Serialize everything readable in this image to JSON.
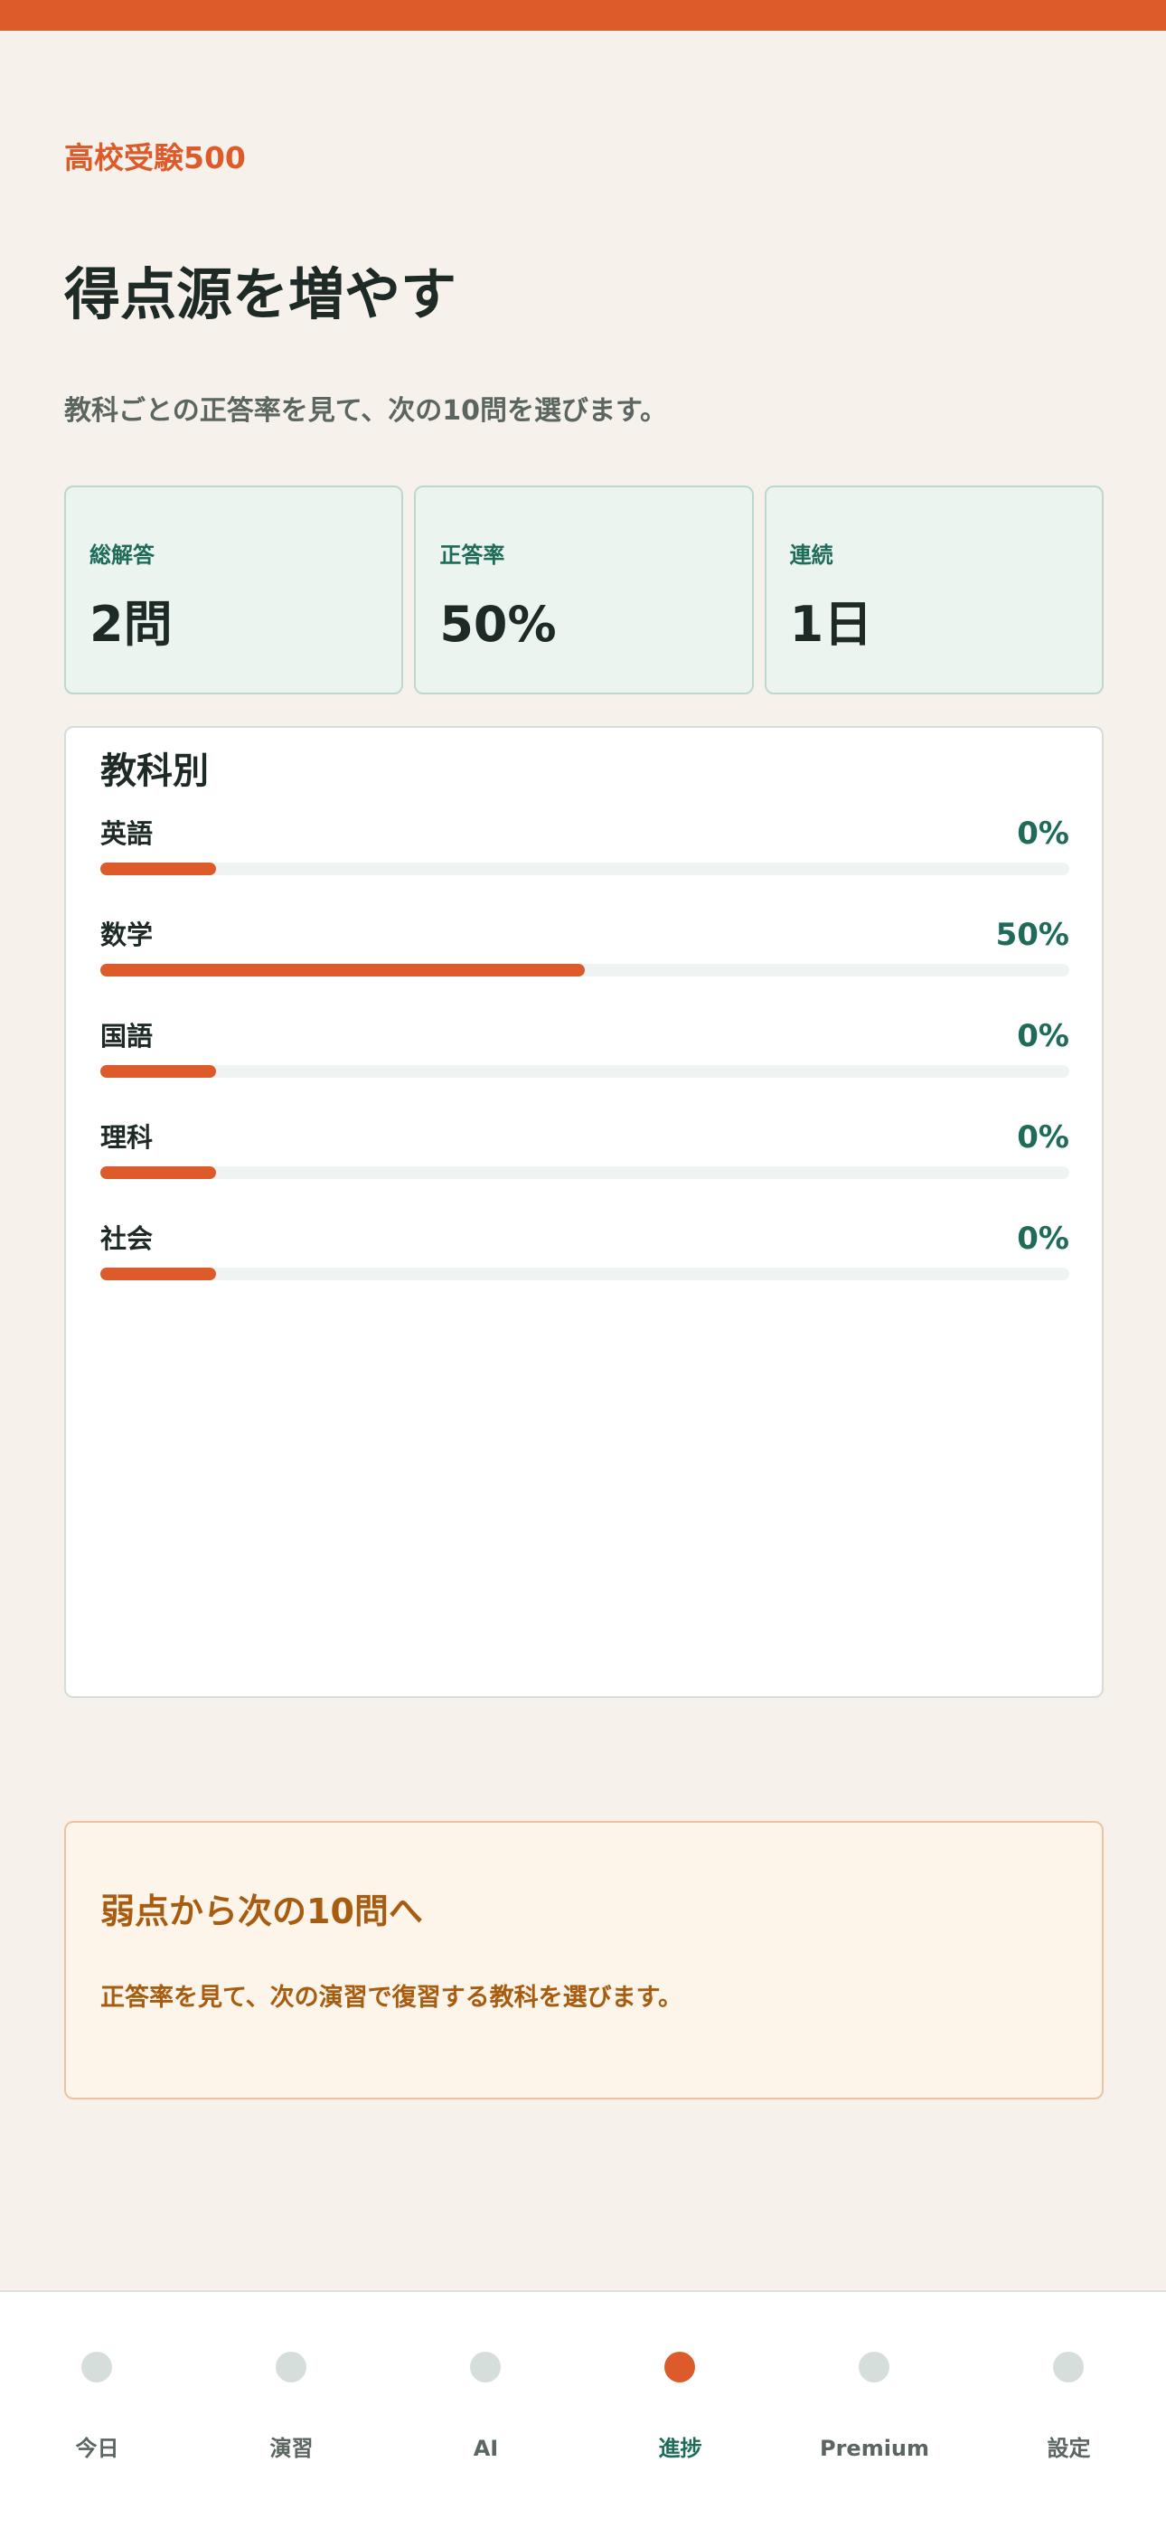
{
  "app": {
    "name": "高校受験500"
  },
  "header": {
    "title": "得点源を増やす",
    "subtitle": "教科ごとの正答率を見て、次の10問を選びます。"
  },
  "stats": [
    {
      "label": "総解答",
      "value": "2問"
    },
    {
      "label": "正答率",
      "value": "50%"
    },
    {
      "label": "連続",
      "value": "1日"
    }
  ],
  "subjects": {
    "title": "教科別",
    "items": [
      {
        "name": "英語",
        "percent_label": "0%",
        "progress": 0
      },
      {
        "name": "数学",
        "percent_label": "50%",
        "progress": 50
      },
      {
        "name": "国語",
        "percent_label": "0%",
        "progress": 0
      },
      {
        "name": "理科",
        "percent_label": "0%",
        "progress": 0
      },
      {
        "name": "社会",
        "percent_label": "0%",
        "progress": 0
      }
    ]
  },
  "tip": {
    "title": "弱点から次の10問へ",
    "body": "正答率を見て、次の演習で復習する教科を選びます。"
  },
  "nav": {
    "active": "進捗",
    "items": [
      {
        "label": "今日",
        "icon": "dot-icon"
      },
      {
        "label": "演習",
        "icon": "dot-icon"
      },
      {
        "label": "AI",
        "icon": "dot-icon"
      },
      {
        "label": "進捗",
        "icon": "dot-icon"
      },
      {
        "label": "Premium",
        "icon": "dot-icon"
      },
      {
        "label": "設定",
        "icon": "dot-icon"
      }
    ]
  },
  "colors": {
    "accent": "#dd5b2a",
    "teal": "#1e6b5a",
    "background": "#f6f1eb",
    "tip_text": "#a85c10"
  }
}
